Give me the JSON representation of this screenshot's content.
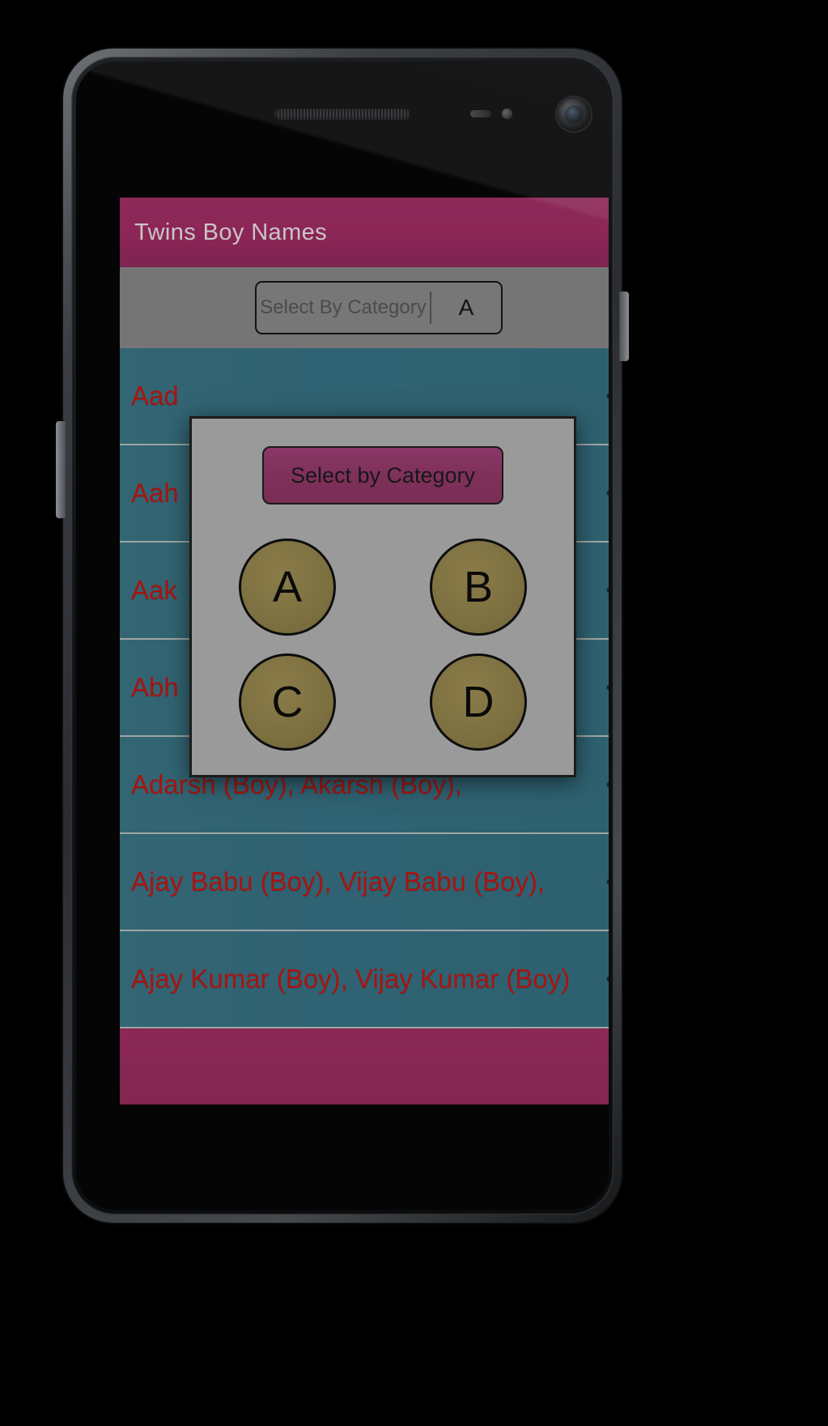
{
  "app": {
    "title": "Twins Boy Names"
  },
  "spinner": {
    "placeholder": "Select By Category",
    "value": "A"
  },
  "dialog": {
    "title": "Select by Category",
    "letters": [
      "A",
      "B",
      "C",
      "D"
    ]
  },
  "list": {
    "rows": [
      {
        "name": "Aad",
        "share_icon": "share-icon"
      },
      {
        "name": "Aah",
        "share_icon": "share-icon"
      },
      {
        "name": "Aak",
        "share_icon": "share-icon"
      },
      {
        "name": "Abh",
        "share_icon": "share-icon"
      },
      {
        "name": "Adarsh (Boy), Akarsh (Boy),",
        "share_icon": "share-icon"
      },
      {
        "name": "Ajay Babu (Boy), Vijay Babu (Boy),",
        "share_icon": "share-icon"
      },
      {
        "name": "Ajay Kumar (Boy), Vijay Kumar (Boy)",
        "share_icon": "share-icon"
      }
    ]
  },
  "colors": {
    "title_bar": "#8c2656",
    "row_background": "#2f6272",
    "row_text": "#a81410",
    "dialog_background": "#9a9a9a",
    "letter_circle": "#7d7040",
    "screen_background": "#757575"
  }
}
